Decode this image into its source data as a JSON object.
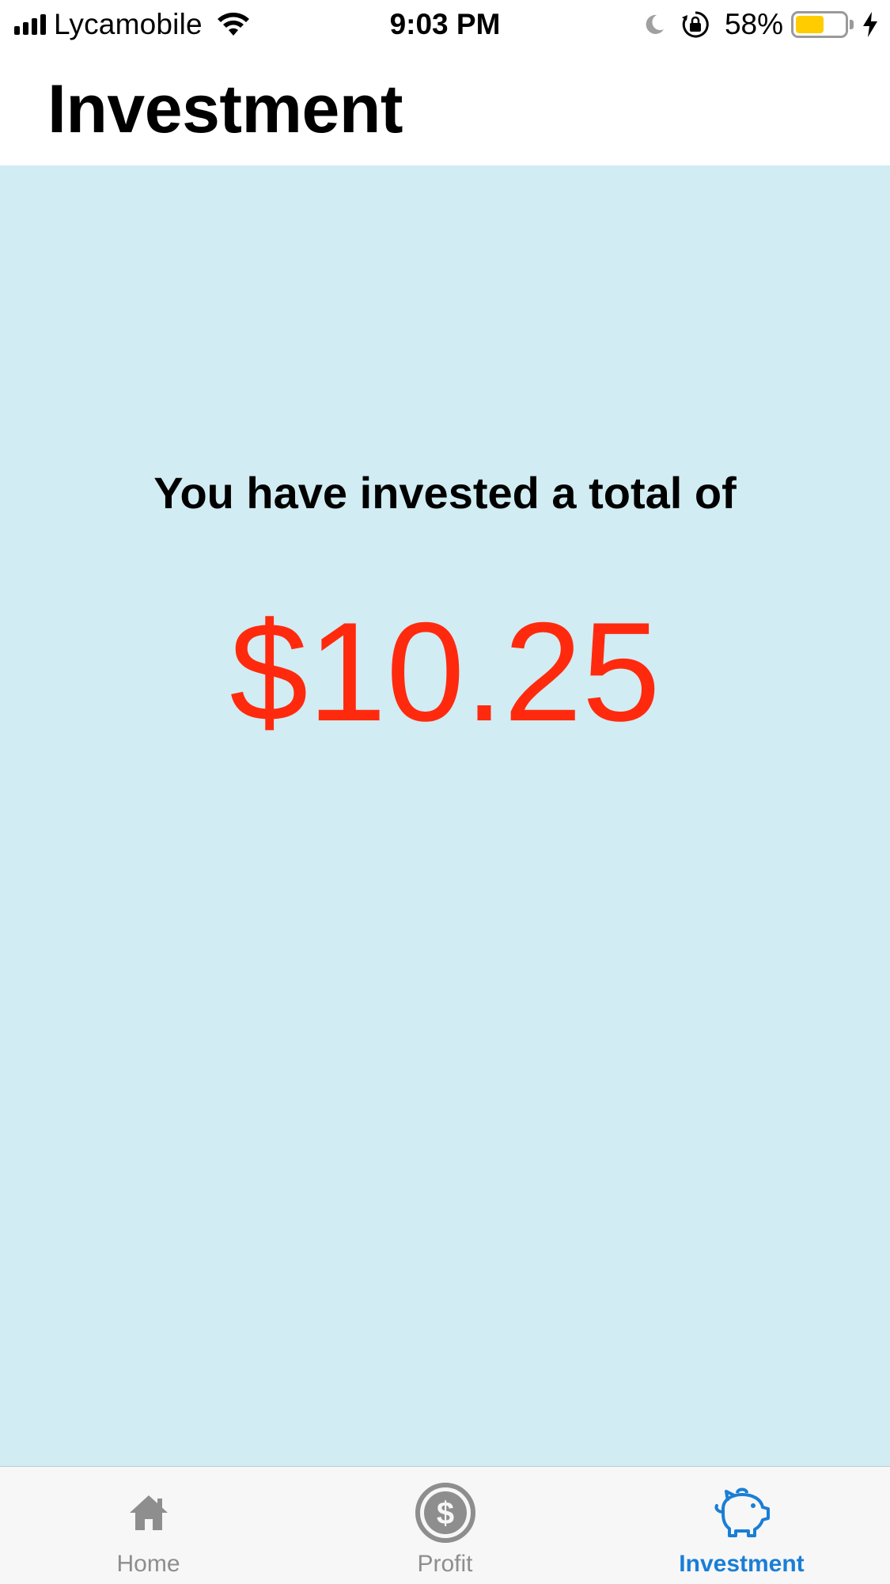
{
  "status_bar": {
    "carrier": "Lycamobile",
    "time": "9:03 PM",
    "battery_percent": "58%",
    "battery_level": 0.58,
    "battery_color": "#ffcc00",
    "icons": [
      "signal-icon",
      "wifi-icon",
      "moon-icon",
      "rotation-lock-icon",
      "battery-icon",
      "charging-bolt-icon"
    ]
  },
  "header": {
    "title": "Investment"
  },
  "main": {
    "headline": "You have invested a total of",
    "amount": "$10.25",
    "background_color": "#d1ecf2",
    "amount_color": "#ff2a0e"
  },
  "tab_bar": {
    "active_color": "#1a7ed6",
    "inactive_color": "#8e8e8e",
    "tabs": [
      {
        "label": "Home",
        "icon": "home-icon",
        "active": false
      },
      {
        "label": "Profit",
        "icon": "dollar-icon",
        "active": false
      },
      {
        "label": "Investment",
        "icon": "piggy-bank-icon",
        "active": true
      }
    ]
  }
}
